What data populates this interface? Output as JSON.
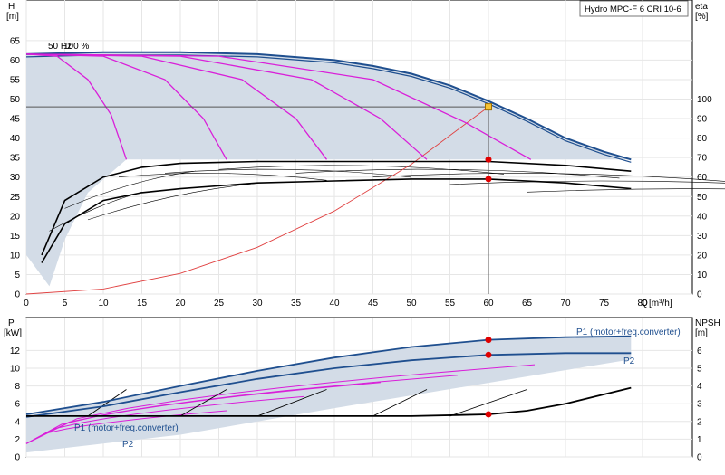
{
  "chart_data": [
    {
      "type": "line",
      "title": "Hydro MPC-F 6 CRI 10-6",
      "ylabel": "H",
      "ylabel_unit": "[m]",
      "xlabel": "Q",
      "xlabel_unit": "[m³/h]",
      "y2label": "eta",
      "y2label_unit": "[%]",
      "xlim": [
        0,
        80
      ],
      "ylim": [
        0,
        65
      ],
      "y2lim": [
        0,
        130
      ],
      "xticks": [
        "0",
        "5",
        "10",
        "15",
        "20",
        "25",
        "30",
        "35",
        "40",
        "45",
        "50",
        "55",
        "60",
        "65",
        "70",
        "75",
        "80"
      ],
      "yticks": [
        "0",
        "5",
        "10",
        "15",
        "20",
        "25",
        "30",
        "35",
        "40",
        "45",
        "50",
        "55",
        "60",
        "65"
      ],
      "y2ticks": [
        "0",
        "10",
        "20",
        "30",
        "40",
        "50",
        "60",
        "70",
        "80",
        "90",
        "100"
      ],
      "annotations": {
        "setpoint_label": "50 Hz",
        "pct_label": "100 %"
      },
      "duty_point": {
        "x": 60,
        "head": 48,
        "eta_points": [
          69,
          59
        ]
      },
      "series": [
        {
          "role": "max-curve",
          "color": "#1f4f8f",
          "x": [
            0,
            10,
            20,
            30,
            40,
            45,
            50,
            55,
            60,
            65,
            70,
            75,
            78.5
          ],
          "y": [
            61.5,
            62,
            62,
            61.5,
            60,
            58.5,
            56.5,
            53.5,
            49.5,
            45,
            40,
            36.5,
            34.5
          ]
        },
        {
          "role": "system-curve",
          "color": "#e04040",
          "x": [
            0,
            10,
            20,
            30,
            40,
            50,
            60
          ],
          "y": [
            0,
            1.3,
            5.3,
            12,
            21.3,
            33.3,
            48
          ]
        },
        {
          "role": "stage-curve",
          "color": "#d91fd9",
          "x": [
            0,
            4,
            8,
            11,
            13
          ],
          "y": [
            61.5,
            61,
            55,
            46,
            34.5
          ]
        },
        {
          "role": "stage-curve",
          "color": "#d91fd9",
          "x": [
            0,
            10,
            18,
            23,
            26
          ],
          "y": [
            61.5,
            61,
            55,
            45,
            34.5
          ]
        },
        {
          "role": "stage-curve",
          "color": "#d91fd9",
          "x": [
            0,
            15,
            28,
            35,
            39
          ],
          "y": [
            61.5,
            61,
            55,
            45,
            34.5
          ]
        },
        {
          "role": "stage-curve",
          "color": "#d91fd9",
          "x": [
            0,
            20,
            37,
            46,
            52
          ],
          "y": [
            61.5,
            61,
            55,
            45,
            34.5
          ]
        },
        {
          "role": "stage-curve",
          "color": "#d91fd9",
          "x": [
            0,
            25,
            45,
            57,
            65.5
          ],
          "y": [
            61.5,
            61,
            55,
            44,
            34.5
          ]
        },
        {
          "role": "eta-curve",
          "color": "#000000",
          "x": [
            2,
            5,
            10,
            15,
            20,
            30,
            40,
            50,
            60,
            70,
            78.5
          ],
          "y": [
            10,
            24,
            30,
            32.5,
            33.5,
            34,
            34,
            34,
            34,
            33,
            31.5
          ]
        },
        {
          "role": "eta-curve",
          "color": "#000000",
          "x": [
            2,
            5,
            10,
            15,
            20,
            30,
            40,
            50,
            60,
            70,
            78.5
          ],
          "y": [
            8,
            18,
            24,
            26,
            27,
            28.5,
            29,
            29.5,
            29.5,
            28.5,
            27
          ]
        }
      ]
    },
    {
      "type": "line",
      "ylabel": "P",
      "ylabel_unit": "[kW]",
      "y2label": "NPSH",
      "y2label_unit": "[m]",
      "xlim": [
        0,
        80
      ],
      "ylim": [
        0,
        14
      ],
      "y2lim": [
        0,
        7
      ],
      "yticks": [
        "0",
        "2",
        "4",
        "6",
        "8",
        "10",
        "12"
      ],
      "y2ticks": [
        "0",
        "1",
        "2",
        "3",
        "4",
        "5",
        "6"
      ],
      "labels": {
        "p1_top": "P1 (motor+freq.converter)",
        "p2_top": "P2",
        "p1_bottom": "P1 (motor+freq.converter)",
        "p2_bottom": "P2"
      },
      "duty_point": {
        "x": 60,
        "p1": 13.2,
        "p2": 11.5,
        "npsh": 2.4
      },
      "series": [
        {
          "role": "P1",
          "color": "#1f4f8f",
          "x": [
            0,
            10,
            20,
            30,
            40,
            50,
            60,
            70,
            78.5
          ],
          "y": [
            4.8,
            6.2,
            8.0,
            9.7,
            11.2,
            12.4,
            13.2,
            13.5,
            13.6
          ]
        },
        {
          "role": "P2",
          "color": "#1f4f8f",
          "x": [
            0,
            10,
            20,
            30,
            40,
            50,
            60,
            70,
            78.5
          ],
          "y": [
            4.5,
            5.7,
            7.3,
            8.8,
            10.0,
            10.9,
            11.5,
            11.7,
            11.7
          ]
        },
        {
          "role": "NPSH",
          "color": "#000000",
          "x": [
            0,
            10,
            20,
            30,
            40,
            50,
            60,
            65,
            70,
            78.5
          ],
          "y": [
            2.3,
            2.3,
            2.3,
            2.3,
            2.3,
            2.3,
            2.4,
            2.6,
            3.0,
            3.9
          ]
        }
      ]
    }
  ]
}
